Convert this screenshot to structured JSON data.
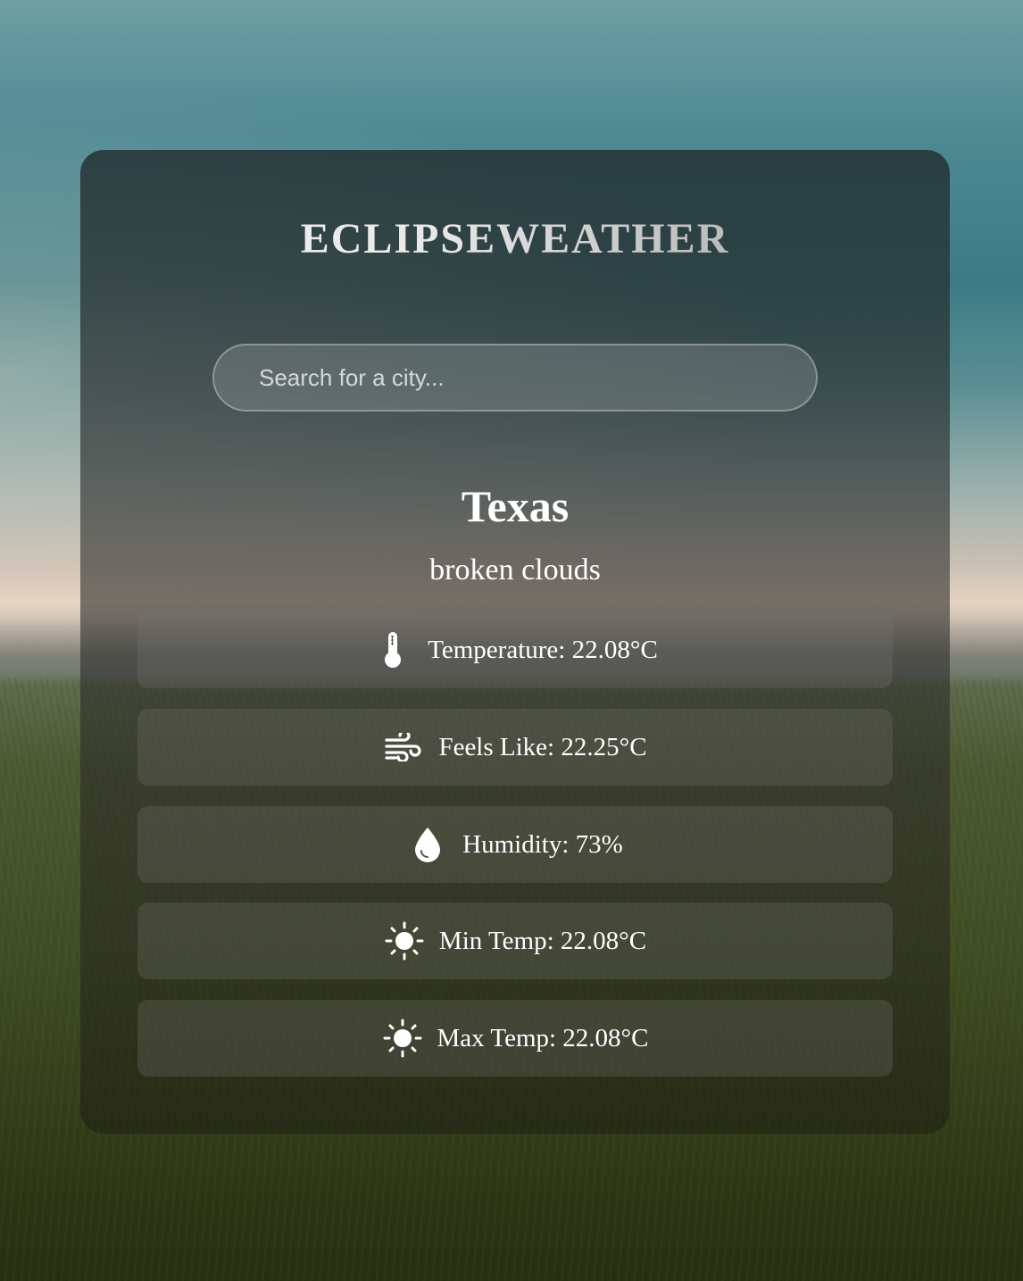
{
  "app": {
    "brand": "ECLIPSEWEATHER"
  },
  "search": {
    "placeholder": "Search for a city...",
    "value": ""
  },
  "location": {
    "city": "Texas",
    "description": "broken clouds"
  },
  "metrics": [
    {
      "icon": "thermometer-icon",
      "text": "Temperature: 22.08°C"
    },
    {
      "icon": "wind-icon",
      "text": "Feels Like: 22.25°C"
    },
    {
      "icon": "droplet-icon",
      "text": "Humidity: 73%"
    },
    {
      "icon": "sun-icon",
      "text": "Min Temp: 22.08°C"
    },
    {
      "icon": "sun-icon",
      "text": "Max Temp: 22.08°C"
    }
  ],
  "colors": {
    "text": "#ffffff",
    "card_bg": "rgba(34,46,48,0.82)"
  }
}
